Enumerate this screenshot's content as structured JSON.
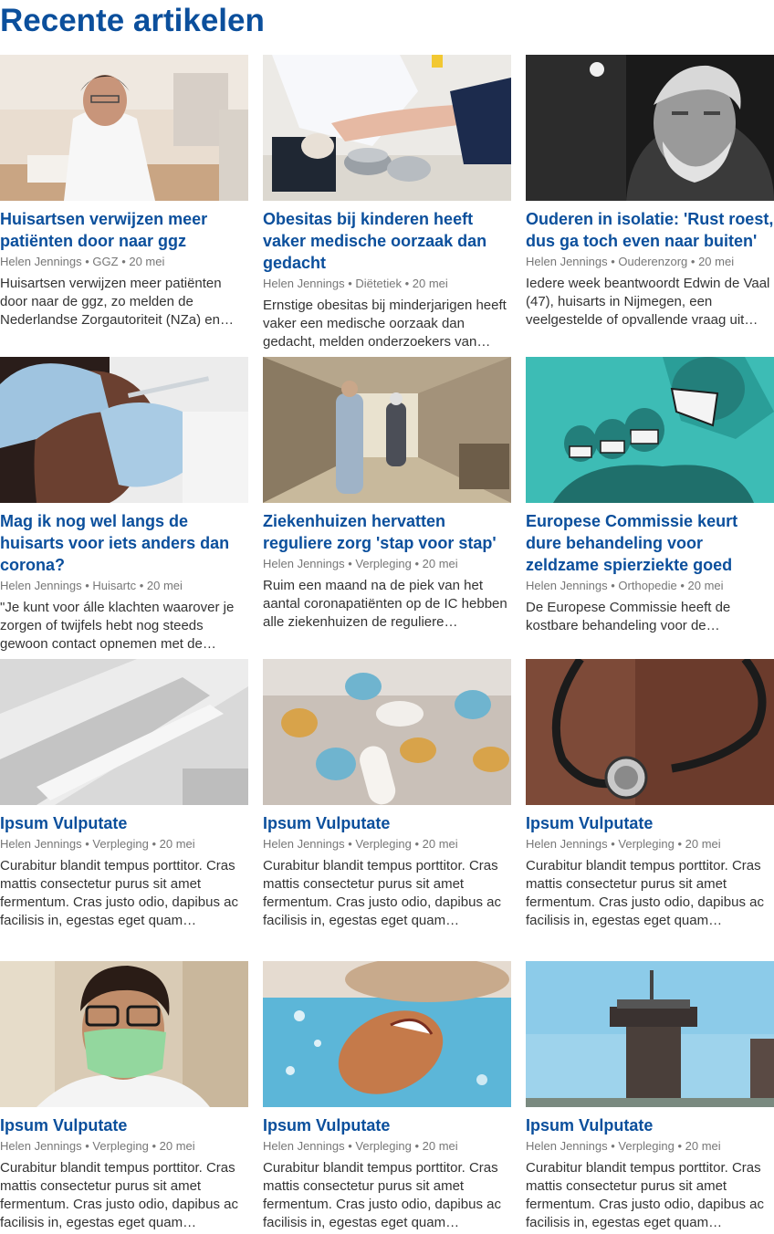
{
  "section": {
    "title": "Recente artikelen"
  },
  "colors": {
    "accent": "#0b4f9c",
    "meta": "#777777",
    "text": "#333333"
  },
  "articles": [
    {
      "image": "doctor-writing-photo",
      "title": "Huisartsen verwijzen meer patiënten door naar ggz",
      "author": "Helen Jennings",
      "category": "GGZ",
      "date": "20 mei",
      "excerpt": "Huisartsen verwijzen meer patiënten door naar de ggz, zo melden de Nederlandse Zorgautoriteit (NZa) en…"
    },
    {
      "image": "blood-draw-photo",
      "title": "Obesitas bij kinderen heeft vaker medische oorzaak dan gedacht",
      "author": "Helen Jennings",
      "category": "Diëtetiek",
      "date": "20 mei",
      "excerpt": "Ernstige obesitas bij minderjarigen heeft vaker een medische oorzaak dan gedacht, melden onderzoekers van…"
    },
    {
      "image": "elderly-man-photo",
      "title": "Ouderen in isolatie: 'Rust roest, dus ga toch even naar buiten'",
      "author": "Helen Jennings",
      "category": "Ouderenzorg",
      "date": "20 mei",
      "excerpt": "Iedere week beantwoordt Edwin de Vaal (47), huisarts in Nijmegen, een veelgestelde of opvallende vraag uit…"
    },
    {
      "image": "vaccination-photo",
      "title": "Mag ik nog wel langs de huisarts voor iets anders dan corona?",
      "author": "Helen Jennings",
      "category": "Huisartc",
      "date": "20 mei",
      "excerpt": "\"Je kunt voor álle klachten waarover je zorgen of twijfels hebt nog steeds gewoon contact opnemen met de…"
    },
    {
      "image": "hospital-corridor-photo",
      "title": "Ziekenhuizen hervatten reguliere zorg 'stap voor stap'",
      "author": "Helen Jennings",
      "category": "Verpleging",
      "date": "20 mei",
      "excerpt": "Ruim een maand na de piek van het aantal coronapatiënten op de IC hebben alle ziekenhuizen de reguliere…"
    },
    {
      "image": "medical-team-illustration",
      "title": "Europese Commissie keurt dure behandeling voor zeldzame spierziekte goed",
      "author": "Helen Jennings",
      "category": "Orthopedie",
      "date": "20 mei",
      "excerpt": "De Europese Commissie heeft de kostbare behandeling voor de…"
    },
    {
      "image": "syringe-photo",
      "title": "Ipsum Vulputate",
      "author": "Helen Jennings",
      "category": "Verpleging",
      "date": "20 mei",
      "excerpt": "Curabitur blandit tempus porttitor. Cras mattis consectetur purus sit amet fermentum. Cras justo odio, dapibus ac facilisis in, egestas eget quam…"
    },
    {
      "image": "pills-photo",
      "title": "Ipsum Vulputate",
      "author": "Helen Jennings",
      "category": "Verpleging",
      "date": "20 mei",
      "excerpt": "Curabitur blandit tempus porttitor. Cras mattis consectetur purus sit amet fermentum. Cras justo odio, dapibus ac facilisis in, egestas eget quam…"
    },
    {
      "image": "stethoscope-photo",
      "title": "Ipsum Vulputate",
      "author": "Helen Jennings",
      "category": "Verpleging",
      "date": "20 mei",
      "excerpt": "Curabitur blandit tempus porttitor. Cras mattis consectetur purus sit amet fermentum. Cras justo odio, dapibus ac facilisis in, egestas eget quam…"
    },
    {
      "image": "masked-doctor-photo",
      "title": "Ipsum Vulputate",
      "author": "Helen Jennings",
      "category": "Verpleging",
      "date": "20 mei",
      "excerpt": "Curabitur blandit tempus porttitor. Cras mattis consectetur purus sit amet fermentum. Cras justo odio, dapibus ac facilisis in, egestas eget quam…"
    },
    {
      "image": "swimmer-photo",
      "title": "Ipsum Vulputate",
      "author": "Helen Jennings",
      "category": "Verpleging",
      "date": "20 mei",
      "excerpt": "Curabitur blandit tempus porttitor. Cras mattis consectetur purus sit amet fermentum. Cras justo odio, dapibus ac facilisis in, egestas eget quam…"
    },
    {
      "image": "tower-photo",
      "title": "Ipsum Vulputate",
      "author": "Helen Jennings",
      "category": "Verpleging",
      "date": "20 mei",
      "excerpt": "Curabitur blandit tempus porttitor. Cras mattis consectetur purus sit amet fermentum. Cras justo odio, dapibus ac facilisis in, egestas eget quam…"
    }
  ]
}
